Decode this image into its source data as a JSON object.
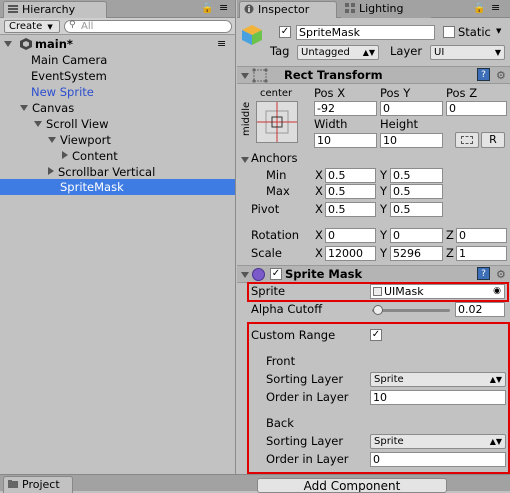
{
  "hierarchy": {
    "tab_label": "Hierarchy",
    "create_label": "Create",
    "search_placeholder": "All",
    "scene_name": "main*",
    "items": [
      {
        "label": "Main Camera"
      },
      {
        "label": "EventSystem"
      },
      {
        "label": "New Sprite"
      },
      {
        "label": "Canvas"
      },
      {
        "label": "Scroll View"
      },
      {
        "label": "Viewport"
      },
      {
        "label": "Content"
      },
      {
        "label": "Scrollbar Vertical"
      },
      {
        "label": "SpriteMask"
      }
    ]
  },
  "project": {
    "tab_label": "Project"
  },
  "inspector": {
    "tab_label": "Inspector",
    "lighting_tab_label": "Lighting",
    "object_name": "SpriteMask",
    "static_label": "Static",
    "tag_label": "Tag",
    "tag_value": "Untagged",
    "layer_label": "Layer",
    "layer_value": "UI"
  },
  "rect_transform": {
    "title": "Rect Transform",
    "anchor_preset_top": "center",
    "anchor_preset_side": "middle",
    "pos_x_label": "Pos X",
    "pos_y_label": "Pos Y",
    "pos_z_label": "Pos Z",
    "pos_x": "-92",
    "pos_y": "0",
    "pos_z": "0",
    "width_label": "Width",
    "height_label": "Height",
    "width": "10",
    "height": "10",
    "r_button": "R",
    "anchors_label": "Anchors",
    "min_label": "Min",
    "max_label": "Max",
    "pivot_label": "Pivot",
    "min_x": "0.5",
    "min_y": "0.5",
    "max_x": "0.5",
    "max_y": "0.5",
    "pivot_x": "0.5",
    "pivot_y": "0.5",
    "rotation_label": "Rotation",
    "scale_label": "Scale",
    "rot_x": "0",
    "rot_y": "0",
    "rot_z": "0",
    "scale_x": "12000",
    "scale_y": "5296",
    "scale_z": "1",
    "x_letter": "X",
    "y_letter": "Y",
    "z_letter": "Z"
  },
  "sprite_mask": {
    "title": "Sprite Mask",
    "sprite_label": "Sprite",
    "sprite_value": "UIMask",
    "alpha_cutoff_label": "Alpha Cutoff",
    "alpha_cutoff_value": "0.02",
    "alpha_cutoff_fraction": 0.02,
    "custom_range_label": "Custom Range",
    "front_label": "Front",
    "front_sorting_layer_label": "Sorting Layer",
    "front_sorting_layer_value": "Sprite",
    "front_order_label": "Order in Layer",
    "front_order_value": "10",
    "back_label": "Back",
    "back_sorting_layer_label": "Sorting Layer",
    "back_sorting_layer_value": "Sprite",
    "back_order_label": "Order in Layer",
    "back_order_value": "0"
  },
  "add_component_label": "Add Component",
  "colors": {
    "selection": "#3e7ce4",
    "highlight_box": "#e00000",
    "new_sprite_text": "#2b4ed0"
  }
}
